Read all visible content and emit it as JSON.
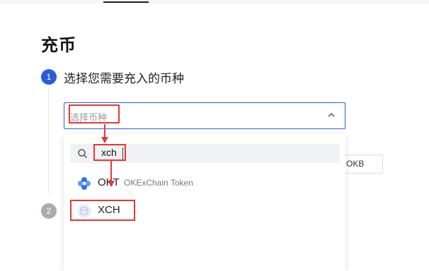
{
  "page": {
    "title": "充币"
  },
  "steps": [
    {
      "number": "1",
      "label": "选择您需要充入的币种"
    },
    {
      "number": "2",
      "label": ""
    }
  ],
  "coin_select": {
    "placeholder": "选择币种",
    "search_value": "xch"
  },
  "side_button": {
    "label": "OKB"
  },
  "coin_options": [
    {
      "symbol": "OKT",
      "name": "OKExChain Token",
      "icon": "okt-coin-icon"
    },
    {
      "symbol": "XCH",
      "name": "",
      "icon": "xch-coin-icon"
    }
  ],
  "colors": {
    "accent": "#2b5bd7",
    "annotation": "#e53935",
    "step_inactive": "#a9abb0"
  }
}
